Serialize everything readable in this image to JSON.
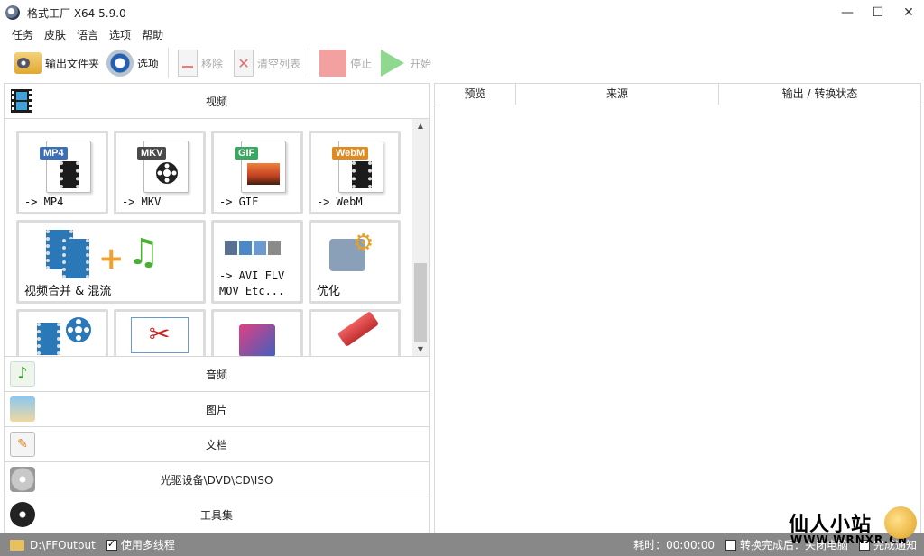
{
  "window": {
    "title": "格式工厂 X64 5.9.0",
    "controls": [
      "—",
      "☐",
      "✕"
    ]
  },
  "menu": [
    "任务",
    "皮肤",
    "语言",
    "选项",
    "帮助"
  ],
  "toolbar": {
    "output_folder": "输出文件夹",
    "options": "选项",
    "remove": "移除",
    "clear_list": "清空列表",
    "stop": "停止",
    "start": "开始"
  },
  "categories": {
    "video": "视频",
    "audio": "音频",
    "image": "图片",
    "document": "文档",
    "optical": "光驱设备\\DVD\\CD\\ISO",
    "tools": "工具集"
  },
  "video_tiles": [
    {
      "badge": "MP4",
      "label": "-> MP4",
      "badge_color": "#3c6fb8"
    },
    {
      "badge": "MKV",
      "label": "-> MKV",
      "badge_color": "#4a4a4a"
    },
    {
      "badge": "GIF",
      "label": "-> GIF",
      "badge_color": "#3aa860"
    },
    {
      "badge": "WebM",
      "label": "-> WebM",
      "badge_color": "#e08a20"
    },
    {
      "label": "视频合并 & 混流"
    },
    {
      "label": "-> AVI FLV\nMOV Etc..."
    },
    {
      "label": "优化"
    }
  ],
  "table_headers": [
    "预览",
    "来源",
    "输出 / 转换状态"
  ],
  "status": {
    "output_path": "D:\\FFOutput",
    "multithread": "使用多线程",
    "elapsed": "耗时：00:00:00",
    "after_convert": "转换完成后：关闭电脑",
    "notify": "完成通知"
  },
  "watermark": {
    "title": "仙人小站",
    "url": "WWW.WRNXR.CN"
  }
}
